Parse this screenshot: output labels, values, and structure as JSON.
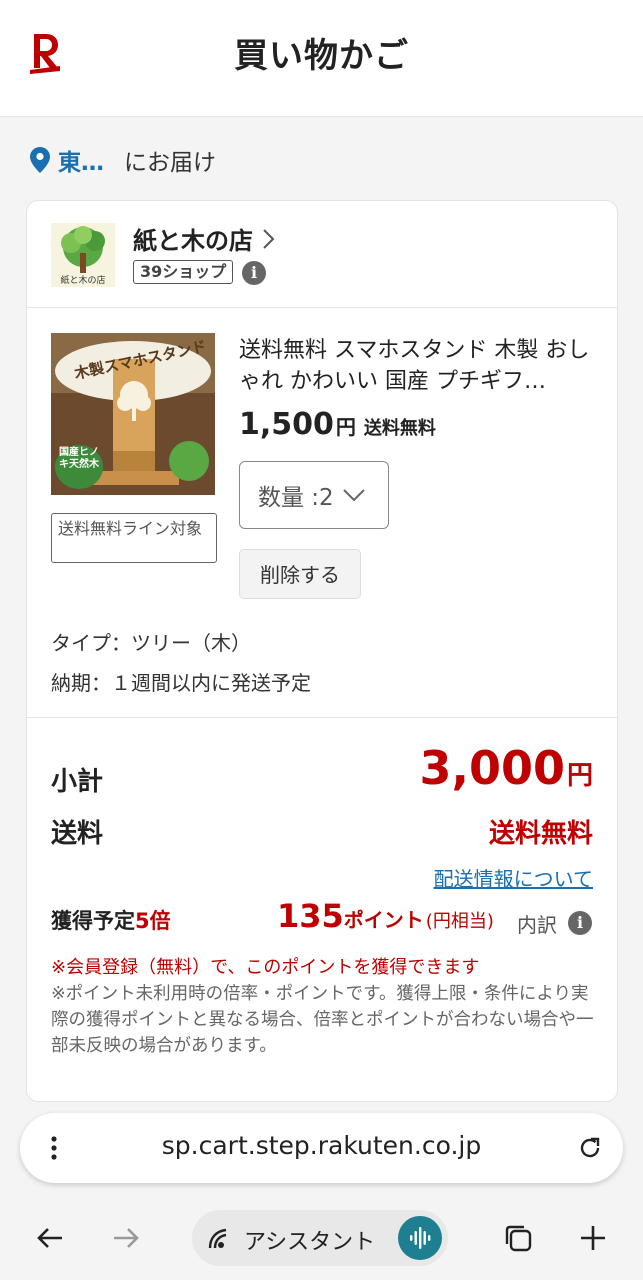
{
  "header": {
    "title": "買い物かご",
    "logo": "rakuten-R-logo"
  },
  "delivery": {
    "location": "東…",
    "text": "にお届け"
  },
  "shop": {
    "name": "紙と木の店",
    "badge": "39ショップ",
    "logo_caption": "紙と木の店"
  },
  "product": {
    "name": "送料無料 スマホスタンド 木製 おしゃれ かわいい 国産 プチギフ…",
    "image_title": "木製スマホスタンド",
    "image_badge": "国産ヒノキ天然木",
    "price": "1,500",
    "price_unit": "円",
    "shipping": "送料無料",
    "shipping_tag": "送料無料ライン対象",
    "quantity_label": "数量 :2",
    "delete_label": "削除する",
    "type_line": "タイプ：ツリー（木）",
    "delivery_line": "納期：１週間以内に発送予定"
  },
  "totals": {
    "subtotal_label": "小計",
    "subtotal_value": "3,000",
    "subtotal_unit": "円",
    "shipping_label": "送料",
    "shipping_value": "送料無料",
    "shipping_link": "配送情報について",
    "points_label": "獲得予定",
    "points_multiplier": "5倍",
    "points_value": "135",
    "points_unit": "ポイント",
    "points_equiv": "(円相当)",
    "points_breakdown": "内訳",
    "note_member": "※会員登録（無料）で、このポイントを獲得できます",
    "note_detail": "※ポイント未利用時の倍率・ポイントです。獲得上限・条件により実際の獲得ポイントと異なる場合、倍率とポイントが合わない場合や一部未反映の場合があります。"
  },
  "browser": {
    "url": "sp.cart.step.rakuten.co.jp",
    "assistant_label": "アシスタント"
  },
  "colors": {
    "accent_red": "#bf0000",
    "link_blue": "#1a6fb0",
    "mic_teal": "#1d7f8f"
  }
}
